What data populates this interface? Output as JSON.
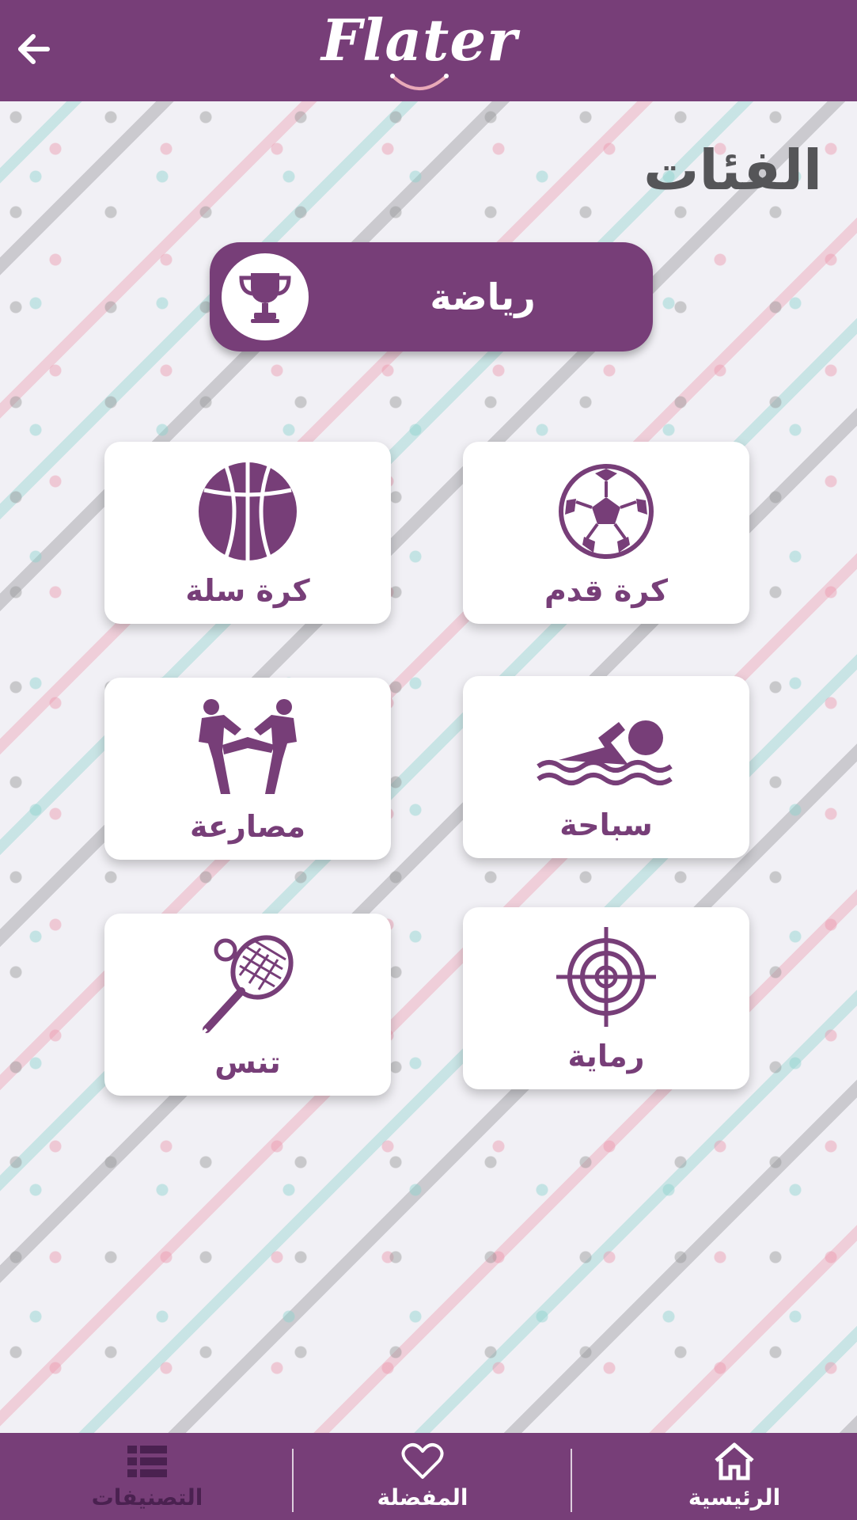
{
  "header": {
    "logo_text": "Flater",
    "back_icon": "arrow-left-icon"
  },
  "page": {
    "title": "الفئات"
  },
  "category": {
    "label": "رياضة",
    "icon": "trophy-icon"
  },
  "cards": [
    {
      "label": "كرة قدم",
      "icon": "soccer-ball-icon"
    },
    {
      "label": "كرة سلة",
      "icon": "basketball-icon"
    },
    {
      "label": "سباحة",
      "icon": "swimming-icon"
    },
    {
      "label": "مصارعة",
      "icon": "wrestling-icon"
    },
    {
      "label": "رماية",
      "icon": "target-icon"
    },
    {
      "label": "تنس",
      "icon": "tennis-icon"
    }
  ],
  "bottom_nav": {
    "home_label": "الرئيسية",
    "favorites_label": "المفضلة",
    "categories_label": "التصنيفات"
  },
  "colors": {
    "brand": "#773e78",
    "title": "#555558",
    "card_bg": "#ffffff",
    "page_bg": "#f1f0f5"
  }
}
